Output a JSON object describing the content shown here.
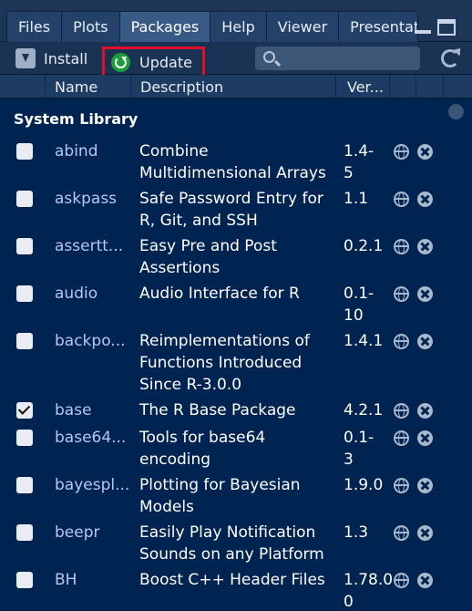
{
  "tabs": [
    {
      "label": "Files"
    },
    {
      "label": "Plots"
    },
    {
      "label": "Packages",
      "active": true
    },
    {
      "label": "Help"
    },
    {
      "label": "Viewer"
    },
    {
      "label": "Presentati"
    }
  ],
  "toolbar": {
    "install_label": "Install",
    "update_label": "Update",
    "search_placeholder": ""
  },
  "columns": {
    "name": "Name",
    "description": "Description",
    "version": "Ver..."
  },
  "section_title": "System Library",
  "packages": [
    {
      "name": "abind",
      "description": "Combine Multidimensional Arrays",
      "version": "1.4-5",
      "checked": false
    },
    {
      "name": "askpass",
      "description": "Safe Password Entry for R, Git, and SSH",
      "version": "1.1",
      "checked": false
    },
    {
      "name": "assertt...",
      "description": "Easy Pre and Post Assertions",
      "version": "0.2.1",
      "checked": false
    },
    {
      "name": "audio",
      "description": "Audio Interface for R",
      "version": "0.1-10",
      "checked": false
    },
    {
      "name": "backpo...",
      "description": "Reimplementations of Functions Introduced Since R-3.0.0",
      "version": "1.4.1",
      "checked": false
    },
    {
      "name": "base",
      "description": "The R Base Package",
      "version": "4.2.1",
      "checked": true
    },
    {
      "name": "base64...",
      "description": "Tools for base64 encoding",
      "version": "0.1-3",
      "checked": false
    },
    {
      "name": "bayespl...",
      "description": "Plotting for Bayesian Models",
      "version": "1.9.0",
      "checked": false
    },
    {
      "name": "beepr",
      "description": "Easily Play Notification Sounds on any Platform",
      "version": "1.3",
      "checked": false
    },
    {
      "name": "BH",
      "description": "Boost C++ Header Files",
      "version": "1.78.0-0",
      "checked": false
    }
  ],
  "colors": {
    "background": "#002451",
    "package_name": "#b7c6f0",
    "update_highlight": "#e0102a",
    "update_icon": "#1d9c3b"
  }
}
